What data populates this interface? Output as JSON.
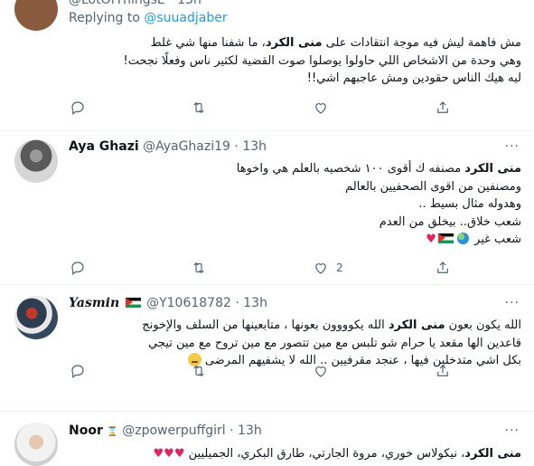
{
  "tweets": [
    {
      "handle": "@LotOfThingsE",
      "time": "13h",
      "replying_label": "Replying to",
      "replying_to": "@suuadjaber",
      "lines": [
        {
          "bold": "منى الكرد",
          "pre": "مش فاهمة ليش فيه موجة انتقادات على ",
          "post": "، ما شفنا منها شي غلط"
        },
        {
          "text": "وهي وحدة من الاشخاص اللي حاولوا يوصلوا صوت القضية لكثير ناس وفعلًا نجحت!"
        },
        {
          "text": "ليه هيك الناس حقودين ومش عاجبهم اشي!!"
        }
      ],
      "actions": {
        "reply": "",
        "retweet": "",
        "like": "",
        "share": ""
      }
    },
    {
      "name": "Aya Ghazi",
      "handle": "@AyaGhazi19",
      "time": "13h",
      "lines": [
        {
          "bold": "منى الكرد",
          "post": " مصنفه ك أقوى ١٠٠ شخصيه بالعلم هي واخوها"
        },
        {
          "text": "ومصنفين من اقوى الصحفيين بالعالم"
        },
        {
          "text": "وهدوله مثال بسيط .."
        },
        {
          "text": "شعب خلاق.. بيخلق من العدم"
        },
        {
          "text": "شعب غير"
        }
      ],
      "actions": {
        "reply": "",
        "retweet": "",
        "like": "2",
        "share": ""
      }
    },
    {
      "name": "Yasmin",
      "handle": "@Y10618782",
      "time": "13h",
      "lines": [
        {
          "pre": "الله يكون بعون ",
          "bold": "منى الكرد",
          "post": " الله يكوووون بعونها ، متابعينها من السلف والإخونج"
        },
        {
          "text": "قاعدين الها مقعد يا حرام  شو تلبس مع مين تتصور مع مين تروح مع مين تيجي"
        },
        {
          "text": "بكل اشي متدخلين فيها ، عنجد مقرفيين .. الله لا يشفيهم المرضى"
        }
      ],
      "actions": {
        "reply": "",
        "retweet": "",
        "like": "",
        "share": ""
      }
    },
    {
      "name": "Noor",
      "handle": "@zpowerpuffgirl",
      "time": "13h",
      "lines": [
        {
          "bold": "منى الكرد",
          "post": "، نيكولاس خوري، مروة الجارتي، طارق البكري، الجميليين"
        }
      ]
    }
  ],
  "colors": {
    "link": "#1d9bf0",
    "muted": "#536471",
    "heart": "#e0245e"
  },
  "icons": [
    "reply-icon",
    "retweet-icon",
    "like-icon",
    "share-icon",
    "more-icon"
  ]
}
